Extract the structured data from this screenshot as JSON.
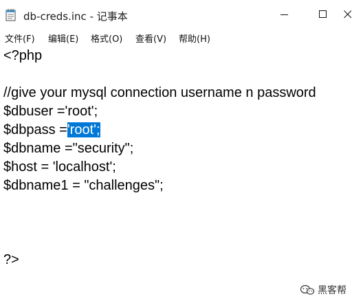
{
  "window": {
    "title": "db-creds.inc - 记事本"
  },
  "menu": [
    {
      "label": "文件(F)"
    },
    {
      "label": "编辑(E)"
    },
    {
      "label": "格式(O)"
    },
    {
      "label": "查看(V)"
    },
    {
      "label": "帮助(H)"
    }
  ],
  "editor": {
    "lines": [
      "<?php",
      "",
      "//give your mysql connection username n password",
      "$dbuser ='root';",
      "$dbpass =",
      "$dbname =\"security\";",
      "$host = 'localhost';",
      "$dbname1 = \"challenges\";",
      "",
      "",
      "",
      "?>"
    ],
    "selected_text": "'root';"
  },
  "watermark": {
    "text": "黑客帮"
  },
  "colors": {
    "selection": "#0078d7",
    "text": "#000000"
  }
}
